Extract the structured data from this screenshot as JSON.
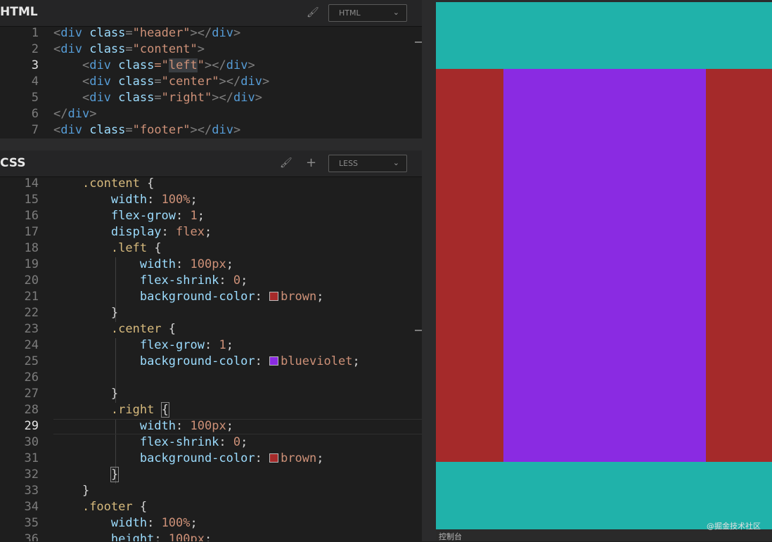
{
  "html_panel": {
    "title": "HTML",
    "language": "HTML",
    "lines": [
      {
        "n": "1",
        "current": false
      },
      {
        "n": "2",
        "current": false
      },
      {
        "n": "3",
        "current": true
      },
      {
        "n": "4",
        "current": false
      },
      {
        "n": "5",
        "current": false
      },
      {
        "n": "6",
        "current": false
      },
      {
        "n": "7",
        "current": false
      }
    ],
    "code": {
      "l1": {
        "a": "<",
        "tag": "div",
        "sp": " ",
        "attr": "class",
        "eq": "=",
        "val": "\"header\"",
        "close": "></",
        "tag2": "div",
        "end": ">"
      },
      "l2": {
        "a": "<",
        "tag": "div",
        "sp": " ",
        "attr": "class",
        "eq": "=",
        "val": "\"content\"",
        "end": ">"
      },
      "l3": {
        "a": "<",
        "tag": "div",
        "sp": " ",
        "attr": "class",
        "eq": "=\"",
        "val": "left",
        "q": "\"",
        "close": "></",
        "tag2": "div",
        "end": ">"
      },
      "l4": {
        "a": "<",
        "tag": "div",
        "sp": " ",
        "attr": "class",
        "eq": "=",
        "val": "\"center\"",
        "close": "></",
        "tag2": "div",
        "end": ">"
      },
      "l5": {
        "a": "<",
        "tag": "div",
        "sp": " ",
        "attr": "class",
        "eq": "=",
        "val": "\"right\"",
        "close": "></",
        "tag2": "div",
        "end": ">"
      },
      "l6": {
        "a": "</",
        "tag": "div",
        "end": ">"
      },
      "l7": {
        "a": "<",
        "tag": "div",
        "sp": " ",
        "attr": "class",
        "eq": "=",
        "val": "\"footer\"",
        "close": "></",
        "tag2": "div",
        "end": ">"
      }
    }
  },
  "css_panel": {
    "title": "CSS",
    "language": "LESS",
    "lines": [
      {
        "n": "14",
        "current": false
      },
      {
        "n": "15",
        "current": false
      },
      {
        "n": "16",
        "current": false
      },
      {
        "n": "17",
        "current": false
      },
      {
        "n": "18",
        "current": false
      },
      {
        "n": "19",
        "current": false
      },
      {
        "n": "20",
        "current": false
      },
      {
        "n": "21",
        "current": false
      },
      {
        "n": "22",
        "current": false
      },
      {
        "n": "23",
        "current": false
      },
      {
        "n": "24",
        "current": false
      },
      {
        "n": "25",
        "current": false
      },
      {
        "n": "26",
        "current": false
      },
      {
        "n": "27",
        "current": false
      },
      {
        "n": "28",
        "current": false
      },
      {
        "n": "29",
        "current": true
      },
      {
        "n": "30",
        "current": false
      },
      {
        "n": "31",
        "current": false
      },
      {
        "n": "32",
        "current": false
      },
      {
        "n": "33",
        "current": false
      },
      {
        "n": "34",
        "current": false
      },
      {
        "n": "35",
        "current": false
      },
      {
        "n": "36",
        "current": false
      }
    ],
    "code": {
      "l14": {
        "sel": ".content",
        "brace": " {"
      },
      "l15": {
        "prop": "width",
        "colon": ": ",
        "val": "100%",
        "semi": ";"
      },
      "l16": {
        "prop": "flex-grow",
        "colon": ": ",
        "val": "1",
        "semi": ";"
      },
      "l17": {
        "prop": "display",
        "colon": ": ",
        "val": "flex",
        "semi": ";"
      },
      "l18": {
        "sel": ".left",
        "brace": " {"
      },
      "l19": {
        "prop": "width",
        "colon": ": ",
        "val": "100px",
        "semi": ";"
      },
      "l20": {
        "prop": "flex-shrink",
        "colon": ": ",
        "val": "0",
        "semi": ";"
      },
      "l21": {
        "prop": "background-color",
        "colon": ": ",
        "val": "brown",
        "semi": ";"
      },
      "l22": {
        "brace": "}"
      },
      "l23": {
        "sel": ".center",
        "brace": " {"
      },
      "l24": {
        "prop": "flex-grow",
        "colon": ": ",
        "val": "1",
        "semi": ";"
      },
      "l25": {
        "prop": "background-color",
        "colon": ": ",
        "val": "blueviolet",
        "semi": ";"
      },
      "l27": {
        "brace": "}"
      },
      "l28": {
        "sel": ".right",
        "brace": "{"
      },
      "l29": {
        "prop": "width",
        "colon": ": ",
        "val": "100px",
        "semi": ";"
      },
      "l30": {
        "prop": "flex-shrink",
        "colon": ": ",
        "val": "0",
        "semi": ";"
      },
      "l31": {
        "prop": "background-color",
        "colon": ": ",
        "val": "brown",
        "semi": ";"
      },
      "l32": {
        "brace": "}"
      },
      "l33": {
        "brace": "}"
      },
      "l34": {
        "sel": ".footer",
        "brace": " {"
      },
      "l35": {
        "prop": "width",
        "colon": ": ",
        "val": "100%",
        "semi": ";"
      },
      "l36": {
        "prop": "height",
        "colon": ": ",
        "val": "100px",
        "semi": ";"
      }
    }
  },
  "colors": {
    "brown": "#a52a2a",
    "blueviolet": "#8a2be2",
    "lightseagreen": "#20b2aa"
  },
  "icons": {
    "format": "paint-brush-icon",
    "add": "plus-icon",
    "dropdown": "chevron-down-icon"
  },
  "preview": {
    "console_label": "控制台",
    "watermark": "@掘金技术社区"
  }
}
